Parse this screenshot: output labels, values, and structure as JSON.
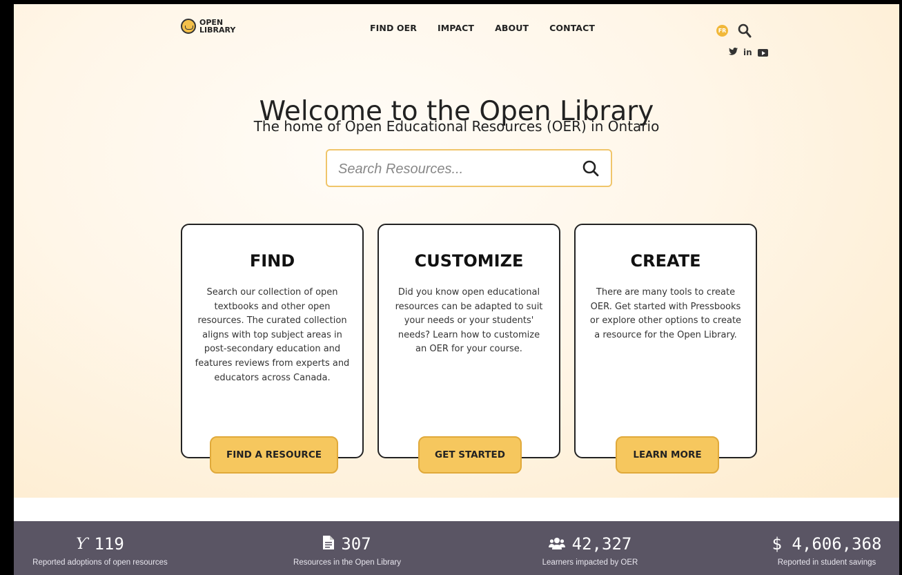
{
  "brand": {
    "logo_line1": "OPEN",
    "logo_line2": "LIBRARY"
  },
  "nav": {
    "items": [
      {
        "label": "FIND OER"
      },
      {
        "label": "IMPACT"
      },
      {
        "label": "ABOUT"
      },
      {
        "label": "CONTACT"
      }
    ]
  },
  "language_badge": "FR",
  "social": {
    "twitter": "🐦",
    "linkedin": "in"
  },
  "hero": {
    "title": "Welcome to the Open Library",
    "subtitle": "The home of Open Educational Resources (OER) in Ontario",
    "search_placeholder": "Search Resources..."
  },
  "cards": [
    {
      "title": "FIND",
      "text": "Search our collection of open textbooks and other open resources. The curated collection aligns with top subject areas in post-secondary education and features reviews from experts and educators across Canada.",
      "button": "FIND A RESOURCE"
    },
    {
      "title": "CUSTOMIZE",
      "text": "Did you know open educational resources can be adapted to suit your needs or your students' needs? Learn how to customize an OER for your course.",
      "button": "GET STARTED"
    },
    {
      "title": "CREATE",
      "text": "There are many tools to create OER. Get started with Pressbooks or explore other options to create a resource for the Open Library.",
      "button": "LEARN MORE"
    }
  ],
  "stats": [
    {
      "icon": "adoption-icon",
      "value": "119",
      "label": "Reported adoptions of open resources"
    },
    {
      "icon": "document-icon",
      "value": "307",
      "label": "Resources in the Open Library"
    },
    {
      "icon": "users-icon",
      "value": "42,327",
      "label": "Learners impacted by OER"
    },
    {
      "icon": "dollar-icon",
      "value": "$ 4,606,368",
      "label": "Reported in student savings"
    }
  ],
  "colors": {
    "accent": "#f6c75e",
    "stats_bar": "#5a5564",
    "text": "#222222"
  }
}
